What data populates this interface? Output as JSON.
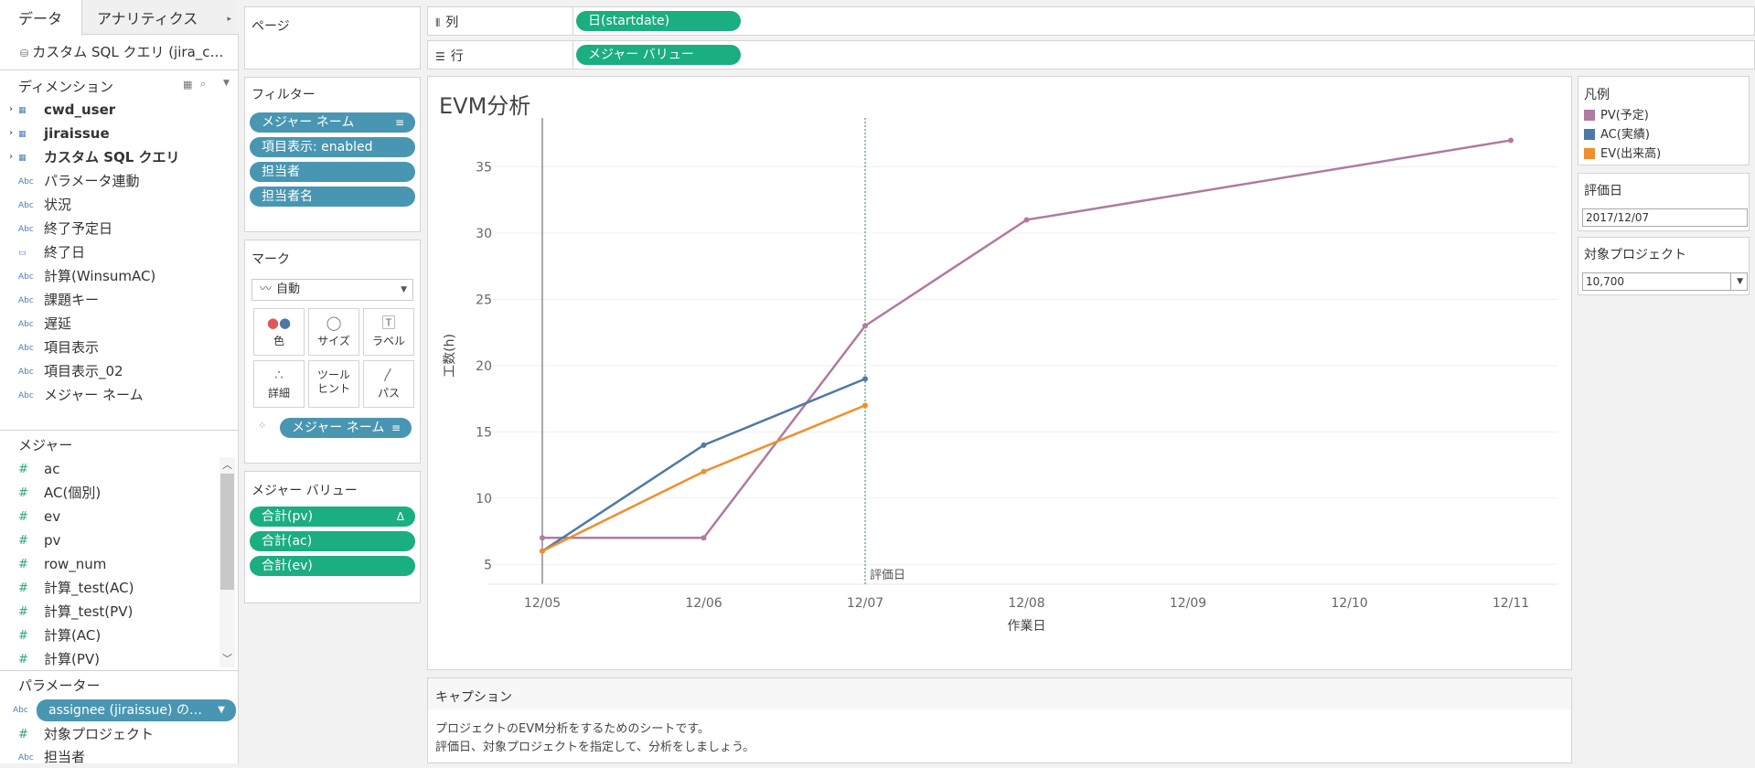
{
  "tabs": {
    "data": "データ",
    "analytics": "アナリティクス",
    "analytics_caret": "▸"
  },
  "datasource": {
    "name": "カスタム SQL クエリ (jira_c…"
  },
  "dimensions": {
    "title": "ディメンション",
    "items": [
      {
        "label": "cwd_user",
        "icon": "table-icon"
      },
      {
        "label": "jiraissue",
        "icon": "table-icon"
      },
      {
        "label": "カスタム SQL クエリ",
        "icon": "table-icon"
      },
      {
        "label": "パラメータ連動",
        "icon": "abc-icon"
      },
      {
        "label": "状況",
        "icon": "abc-icon"
      },
      {
        "label": "終了予定日",
        "icon": "abc-icon"
      },
      {
        "label": "終了日",
        "icon": "date-icon"
      },
      {
        "label": "計算(WinsumAC)",
        "icon": "abc-icon"
      },
      {
        "label": "課題キー",
        "icon": "abc-icon"
      },
      {
        "label": "遅延",
        "icon": "abc-icon"
      },
      {
        "label": "項目表示",
        "icon": "abc-icon"
      },
      {
        "label": "項目表示_02",
        "icon": "abc-icon"
      },
      {
        "label": "メジャー ネーム",
        "icon": "abc-icon"
      }
    ]
  },
  "measures": {
    "title": "メジャー",
    "items": [
      "ac",
      "AC(個別)",
      "ev",
      "pv",
      "row_num",
      "計算_test(AC)",
      "計算_test(PV)",
      "計算(AC)",
      "計算(PV)"
    ]
  },
  "parameters": {
    "title": "パラメーター",
    "pill": "assignee (jiraissue) の…",
    "items": [
      "対象プロジェクト",
      "担当者"
    ]
  },
  "pages": {
    "title": "ページ"
  },
  "filters": {
    "title": "フィルター",
    "pills": [
      "メジャー ネーム",
      "項目表示: enabled",
      "担当者",
      "担当者名"
    ]
  },
  "marks": {
    "title": "マーク",
    "type": "自動",
    "buttons": [
      "色",
      "サイズ",
      "ラベル",
      "詳細",
      "ツール\nヒント",
      "パス"
    ],
    "color_pill": "メジャー ネーム"
  },
  "measure_values": {
    "title": "メジャー バリュー",
    "pills": [
      "合計(pv)",
      "合計(ac)",
      "合計(ev)"
    ]
  },
  "shelves": {
    "columns_label": "列",
    "columns_pill": "日(startdate)",
    "rows_label": "行",
    "rows_pill": "メジャー バリュー"
  },
  "legend": {
    "title": "凡例",
    "items": [
      {
        "label": "PV(予定)",
        "color": "#b07aa1"
      },
      {
        "label": "AC(実績)",
        "color": "#4e79a7"
      },
      {
        "label": "EV(出来高)",
        "color": "#f28e2b"
      }
    ]
  },
  "eval_date": {
    "title": "評価日",
    "value": "2017/12/07"
  },
  "target_project": {
    "title": "対象プロジェクト",
    "value": "10,700"
  },
  "caption": {
    "title": "キャプション",
    "lines": [
      "プロジェクトのEVM分析をするためのシートです。",
      "評価日、対象プロジェクトを指定して、分析をしましょう。"
    ]
  },
  "chart_data": {
    "type": "line",
    "title": "EVM分析",
    "xlabel": "作業日",
    "ylabel": "工数(h)",
    "x_ticks": [
      "12/05",
      "12/06",
      "12/07",
      "12/08",
      "12/09",
      "12/10",
      "12/11"
    ],
    "y_ticks": [
      5,
      10,
      15,
      20,
      25,
      30,
      35
    ],
    "ylim": [
      3.5,
      38
    ],
    "reference_line": {
      "label": "評価日",
      "x": "12/07"
    },
    "grid": true,
    "series": [
      {
        "name": "PV(予定)",
        "color": "#b07aa1",
        "x": [
          "12/05",
          "12/06",
          "12/07",
          "12/08",
          "12/11"
        ],
        "values": [
          7,
          7,
          23,
          31,
          37
        ]
      },
      {
        "name": "AC(実績)",
        "color": "#4e79a7",
        "x": [
          "12/05",
          "12/06",
          "12/07"
        ],
        "values": [
          6,
          14,
          19
        ]
      },
      {
        "name": "EV(出来高)",
        "color": "#f28e2b",
        "x": [
          "12/05",
          "12/06",
          "12/07"
        ],
        "values": [
          6,
          12,
          17
        ]
      }
    ]
  }
}
